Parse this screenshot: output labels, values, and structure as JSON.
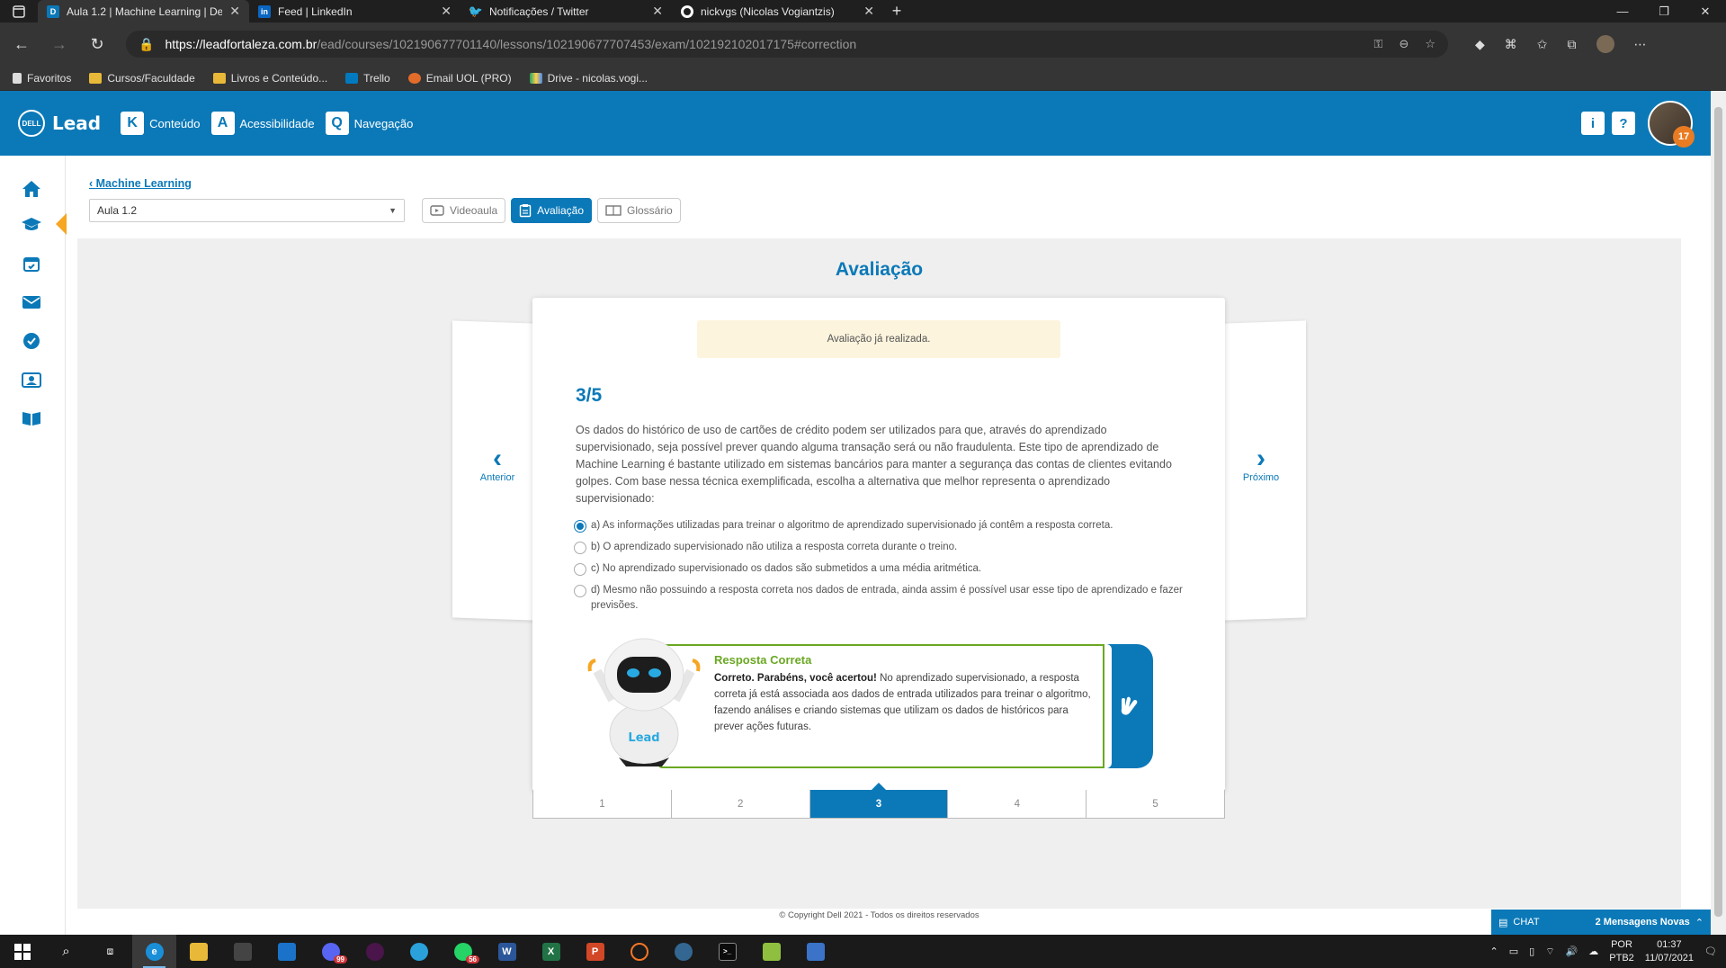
{
  "browser": {
    "tabs": [
      {
        "title": "Aula 1.2 | Machine Learning | De",
        "icon": "dell-icon",
        "color": "#0b79b8",
        "active": true
      },
      {
        "title": "Feed | LinkedIn",
        "icon": "linkedin-icon",
        "color": "#0a66c2"
      },
      {
        "title": "Notificações / Twitter",
        "icon": "twitter-icon",
        "color": "#1d9bf0"
      },
      {
        "title": "nickvgs (Nicolas Vogiantzis)",
        "icon": "github-icon",
        "color": "#ffffff"
      }
    ],
    "url_host": "https://leadfortaleza.com.br",
    "url_path": "/ead/courses/102190677701140/lessons/102190677707453/exam/102192102017175#correction",
    "bookmarks": [
      {
        "label": "Favoritos",
        "icon": "page-icon",
        "color": "#dddddd"
      },
      {
        "label": "Cursos/Faculdade",
        "icon": "folder-icon",
        "color": "#e8b838"
      },
      {
        "label": "Livros e Conteúdo...",
        "icon": "folder-icon",
        "color": "#e8b838"
      },
      {
        "label": "Trello",
        "icon": "trello-icon",
        "color": "#0079bf"
      },
      {
        "label": "Email UOL (PRO)",
        "icon": "uol-icon",
        "color": "#e36c2b"
      },
      {
        "label": "Drive - nicolas.vogi...",
        "icon": "drive-icon",
        "color": "#1fa463"
      }
    ]
  },
  "header": {
    "hotkeys": [
      {
        "key": "K",
        "label": "Conteúdo"
      },
      {
        "key": "A",
        "label": "Acessibilidade"
      },
      {
        "key": "Q",
        "label": "Navegação"
      }
    ],
    "info_label": "i",
    "help_label": "?",
    "notification_count": "17"
  },
  "main": {
    "breadcrumb": "Machine Learning",
    "lesson_select": "Aula 1.2",
    "tabs": [
      {
        "label": "Videoaula",
        "icon": "video-icon",
        "active": false
      },
      {
        "label": "Avaliação",
        "icon": "clipboard-icon",
        "active": true
      },
      {
        "label": "Glossário",
        "icon": "book-icon",
        "active": false
      }
    ],
    "heading": "Avaliação",
    "nav_prev": "Anterior",
    "nav_next": "Próximo"
  },
  "question": {
    "notice": "Avaliação já realizada.",
    "number": "3/5",
    "text": "Os dados do histórico de uso de cartões de crédito podem ser utilizados para que, através do aprendizado supervisionado, seja possível prever quando alguma transação será ou não fraudulenta. Este tipo de aprendizado de Machine Learning é bastante utilizado em sistemas bancários para manter a segurança das contas de clientes evitando golpes. Com base nessa técnica exemplificada, escolha a alternativa que melhor representa o aprendizado supervisionado:",
    "options": [
      {
        "label": "a) As informações utilizadas para treinar o algoritmo de aprendizado supervisionado já contêm a resposta correta.",
        "checked": true
      },
      {
        "label": "b) O aprendizado supervisionado não utiliza a resposta correta durante o treino.",
        "checked": false
      },
      {
        "label": "c) No aprendizado supervisionado os dados são submetidos a uma média aritmética.",
        "checked": false
      },
      {
        "label": "d) Mesmo não possuindo a resposta correta nos dados de entrada, ainda assim é possível usar esse tipo de aprendizado e fazer previsões.",
        "checked": false
      }
    ],
    "feedback": {
      "title": "Resposta Correta",
      "bold": "Correto. Parabéns, você acertou!",
      "text": " No aprendizado supervisionado, a resposta correta já está associada aos dados de entrada utilizados para treinar o algoritmo, fazendo análises e criando sistemas que utilizam os dados de históricos para prever ações futuras.",
      "robot_logo": "Lead"
    },
    "pager": [
      "1",
      "2",
      "3",
      "4",
      "5"
    ],
    "current_page": "3"
  },
  "footer": {
    "copyright": "© Copyright Dell 2021 - Todos os direitos reservados",
    "chat_label": "CHAT",
    "chat_new": "2 Mensagens Novas"
  },
  "taskbar": {
    "apps": [
      {
        "name": "search",
        "label": "",
        "color": "transparent"
      },
      {
        "name": "taskview",
        "label": "",
        "color": "transparent"
      },
      {
        "name": "edge",
        "label": "e",
        "color": "#1a8fd8",
        "active": true
      },
      {
        "name": "explorer",
        "label": "",
        "color": "#e8b838"
      },
      {
        "name": "store",
        "label": "",
        "color": "#444444"
      },
      {
        "name": "mail",
        "label": "",
        "color": "#1a73c8"
      },
      {
        "name": "discord",
        "label": "",
        "color": "#5865f2",
        "badge": "99"
      },
      {
        "name": "slack",
        "label": "",
        "color": "#4a154b"
      },
      {
        "name": "telegram",
        "label": "",
        "color": "#2aa1da"
      },
      {
        "name": "whatsapp",
        "label": "",
        "color": "#25d366",
        "badge": "56"
      },
      {
        "name": "word",
        "label": "W",
        "color": "#2b579a"
      },
      {
        "name": "excel",
        "label": "X",
        "color": "#217346"
      },
      {
        "name": "powerpoint",
        "label": "P",
        "color": "#d24726"
      },
      {
        "name": "jupyter",
        "label": "",
        "color": "#f37626"
      },
      {
        "name": "postgres",
        "label": "",
        "color": "#336791"
      },
      {
        "name": "terminal",
        "label": ">_",
        "color": "#0c0c0c"
      },
      {
        "name": "notepadpp",
        "label": "",
        "color": "#8fbf3f"
      },
      {
        "name": "calculator",
        "label": "",
        "color": "#3a73c8"
      }
    ],
    "lang_top": "POR",
    "lang_bottom": "PTB2",
    "time": "01:37",
    "date": "11/07/2021"
  }
}
